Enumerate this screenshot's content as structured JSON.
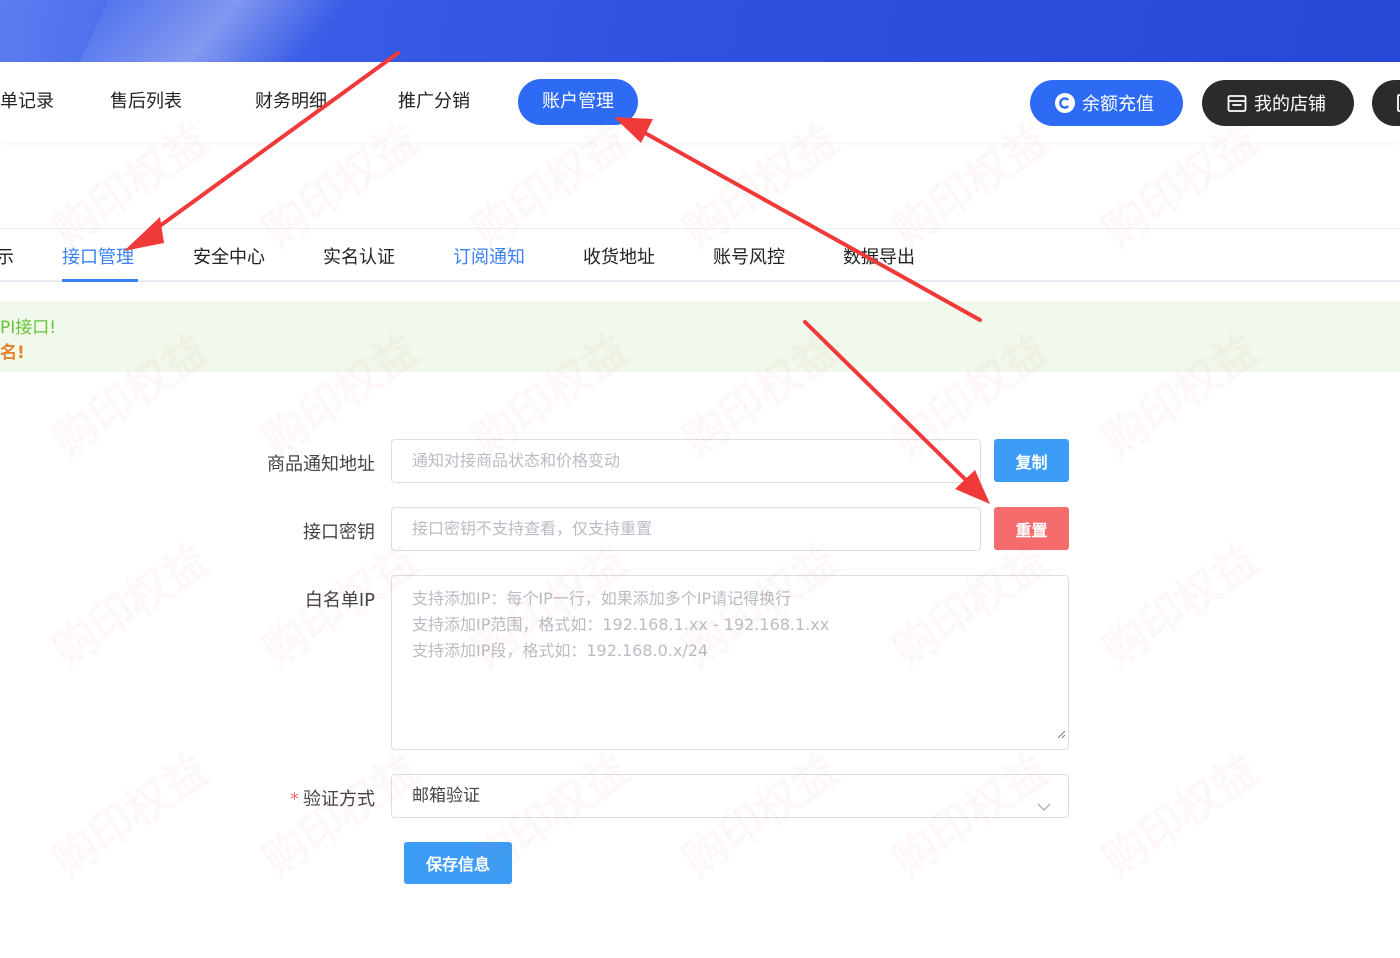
{
  "main_nav": {
    "items": [
      "单记录",
      "售后列表",
      "财务明细",
      "推广分销",
      "账户管理"
    ],
    "active": "账户管理",
    "recharge_label": "余额充值",
    "store_label": "我的店铺"
  },
  "sub_tabs": {
    "items": [
      "示",
      "接口管理",
      "安全中心",
      "实名认证",
      "订阅通知",
      "收货地址",
      "账号风控",
      "数据导出"
    ],
    "active": "接口管理"
  },
  "notice": {
    "line1": "PI接口!",
    "line2": "名!"
  },
  "form": {
    "notify_url": {
      "label": "商品通知地址",
      "placeholder": "通知对接商品状态和价格变动",
      "button": "复制"
    },
    "api_key": {
      "label": "接口密钥",
      "placeholder": "接口密钥不支持查看，仅支持重置",
      "button": "重置"
    },
    "whitelist": {
      "label": "白名单IP",
      "placeholder_lines": [
        "支持添加IP：每个IP一行，如果添加多个IP请记得换行",
        "支持添加IP范围，格式如：192.168.1.xx - 192.168.1.xx",
        "支持添加IP段，格式如：192.168.0.x/24"
      ]
    },
    "verify": {
      "label": "验证方式",
      "required_mark": "*",
      "value": "邮箱验证"
    },
    "save_button": "保存信息"
  },
  "watermark_text": "购印权益",
  "colors": {
    "primary": "#2d6bf5",
    "tab_active": "#3b82f6",
    "danger": "#f56c6c",
    "button_blue": "#3d9df6",
    "annotation_arrow": "#f03a3a"
  }
}
